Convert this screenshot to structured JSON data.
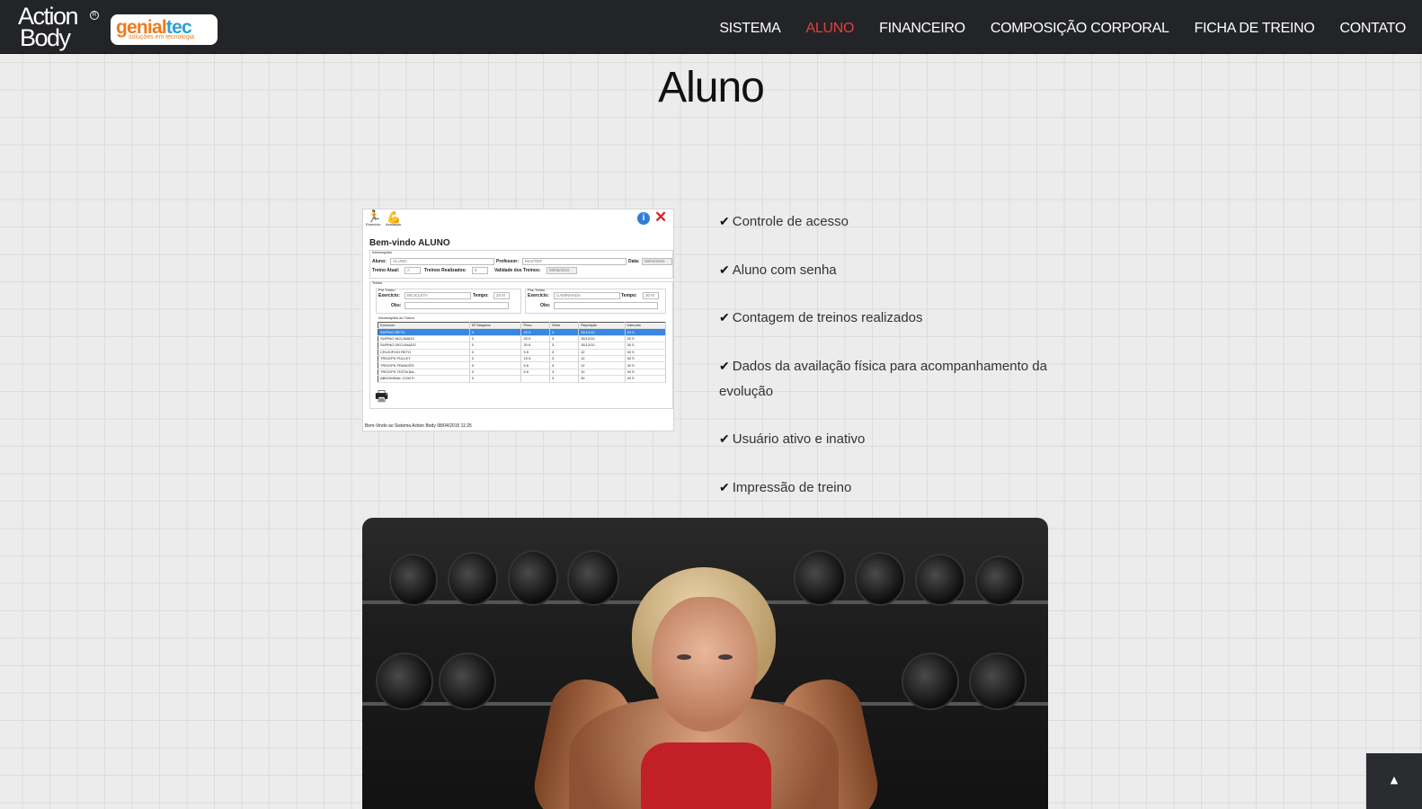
{
  "brand": {
    "action_line1": "Action",
    "action_line2": "Body",
    "registered": "®",
    "genial_a": "genial",
    "genial_b": "tec",
    "genial_tagline": "soluções em tecnologia"
  },
  "nav": {
    "items": [
      {
        "label": "SISTEMA",
        "active": false
      },
      {
        "label": "ALUNO",
        "active": true
      },
      {
        "label": "FINANCEIRO",
        "active": false
      },
      {
        "label": "COMPOSIÇÃO CORPORAL",
        "active": false
      },
      {
        "label": "FICHA DE TREINO",
        "active": false
      },
      {
        "label": "CONTATO",
        "active": false
      }
    ],
    "active_color": "#e0403a"
  },
  "page": {
    "title": "Aluno"
  },
  "screenshot": {
    "icon_exercicio": "Exercício",
    "icon_avaliacao": "Avaliação",
    "welcome": "Bem-vindo  ALUNO",
    "section_info": "Informações",
    "aluno_label": "Aluno:",
    "aluno_value": "ALUNO",
    "professor_label": "Professor:",
    "professor_value": "MASTER",
    "data_label": "Data:",
    "data_value": "08/04/2015",
    "treino_atual_label": "Treino Atual:",
    "treino_atual_value": "A",
    "treinos_realizados_label": "Treinos Realizados:",
    "treinos_realizados_value": "0",
    "validade_label": "Validade dos Treinos:",
    "validade_value": "08/06/2015",
    "section_treino": "Treino",
    "pre_treino": "Pré Treino",
    "pos_treino": "Pós Treino",
    "exercicio_label": "Exercício:",
    "pre_exercicio": "BICICLETA",
    "pos_exercicio": "CAMINHADA",
    "tempo_label": "Tempo:",
    "pre_tempo": "20 M",
    "pos_tempo": "30 M",
    "obs_label": "Obs:",
    "section_info_treino": "Informações do Treino",
    "table_headers": [
      "Exercício",
      "Nº Máquina",
      "Peso",
      "Série",
      "Repetição",
      "Intervalo"
    ],
    "table_rows": [
      [
        "SUPINO RETO",
        "0",
        "20 K",
        "3",
        "15/12/10",
        "30 S"
      ],
      [
        "SUPINO INCLINADO",
        "0",
        "20 K",
        "3",
        "15/12/10",
        "30 S"
      ],
      [
        "SUPINO DECLINADO",
        "0",
        "20 K",
        "3",
        "15/12/10",
        "30 S"
      ],
      [
        "CRUCIFIXO RETO",
        "0",
        "5 K",
        "3",
        "12",
        "30 S"
      ],
      [
        "TRÍCEPS PULLEY",
        "0",
        "15 K",
        "3",
        "12",
        "30 S"
      ],
      [
        "TRÍCEPS FRANCÊS",
        "0",
        "5 K",
        "3",
        "12",
        "30 S"
      ],
      [
        "TRÍCEPS TESTA BA...",
        "0",
        "5 K",
        "3",
        "10",
        "30 S"
      ],
      [
        "ABDOMINAL COM P...",
        "0",
        "",
        "3",
        "30",
        "40 S"
      ]
    ],
    "footer": "Bem-Vindo ao Sistema Action Body  08/04/2015  11:25"
  },
  "features": [
    "Controle de acesso",
    "Aluno com senha",
    "Contagem de treinos realizados",
    "Dados da availação física para acompanhamento da evolução",
    "Usuário ativo e inativo",
    "Impressão de treino"
  ],
  "icons": {
    "check": "✔",
    "info": "i",
    "close": "✕",
    "printer": "🖶",
    "to_top": "▲"
  }
}
